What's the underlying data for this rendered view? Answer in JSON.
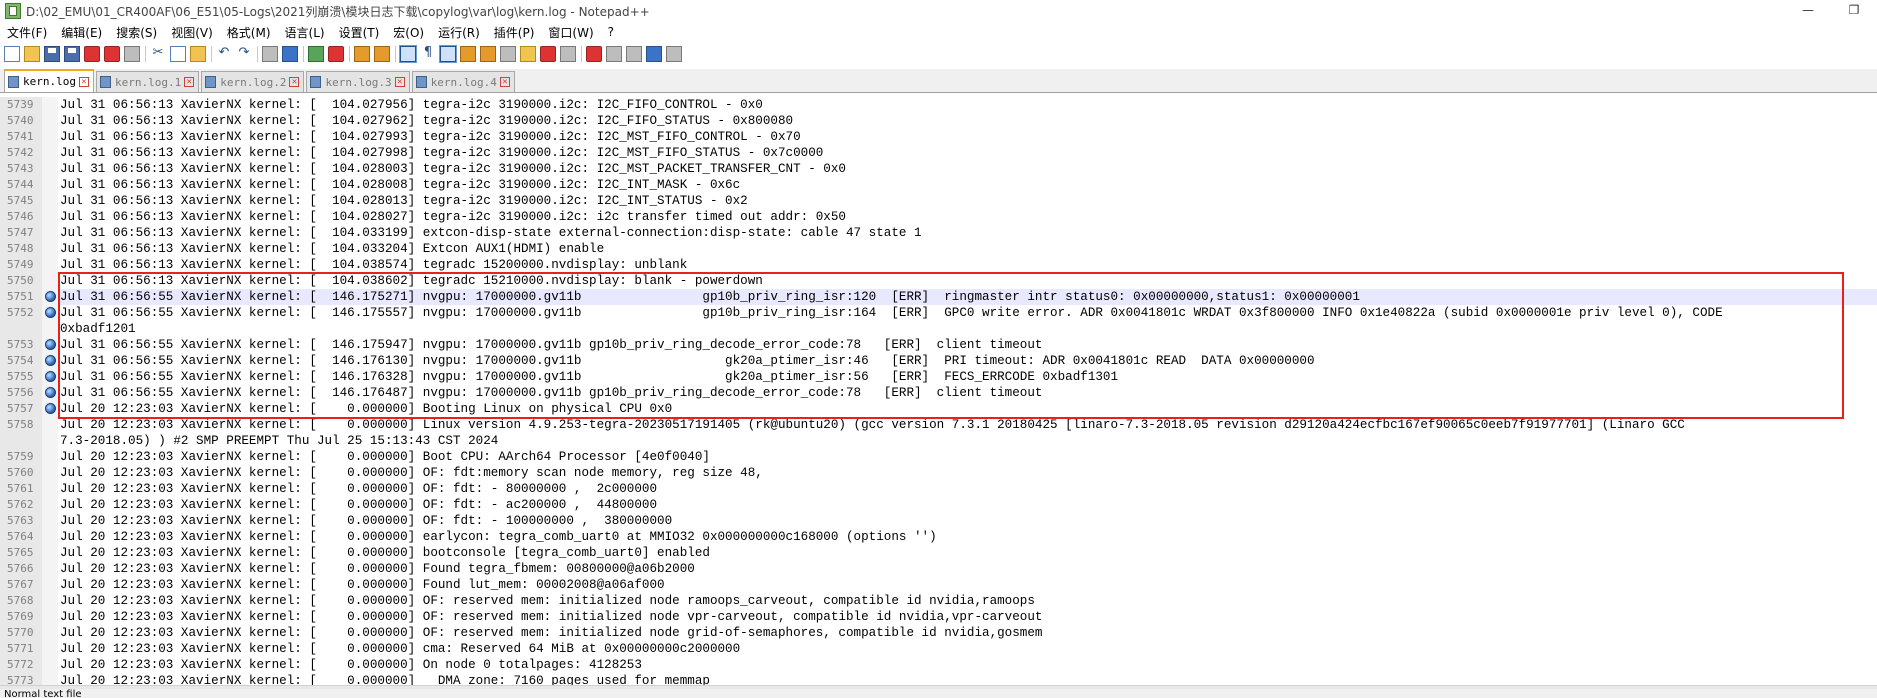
{
  "window": {
    "title": "D:\\02_EMU\\01_CR400AF\\06_E51\\05-Logs\\2021列崩溃\\模块日志下载\\copylog\\var\\log\\kern.log - Notepad++",
    "minimize": "—",
    "restore": "❐"
  },
  "menu": [
    "文件(F)",
    "编辑(E)",
    "搜索(S)",
    "视图(V)",
    "格式(M)",
    "语言(L)",
    "设置(T)",
    "宏(O)",
    "运行(R)",
    "插件(P)",
    "窗口(W)",
    "?"
  ],
  "tabs": [
    {
      "label": "kern.log",
      "active": true
    },
    {
      "label": "kern.log.1",
      "active": false
    },
    {
      "label": "kern.log.2",
      "active": false
    },
    {
      "label": "kern.log.3",
      "active": false
    },
    {
      "label": "kern.log.4",
      "active": false
    }
  ],
  "lines": [
    {
      "num": "5739",
      "text": "Jul 31 06:56:13 XavierNX kernel: [  104.027956] tegra-i2c 3190000.i2c: I2C_FIFO_CONTROL - 0x0"
    },
    {
      "num": "5740",
      "text": "Jul 31 06:56:13 XavierNX kernel: [  104.027962] tegra-i2c 3190000.i2c: I2C_FIFO_STATUS - 0x800080"
    },
    {
      "num": "5741",
      "text": "Jul 31 06:56:13 XavierNX kernel: [  104.027993] tegra-i2c 3190000.i2c: I2C_MST_FIFO_CONTROL - 0x70"
    },
    {
      "num": "5742",
      "text": "Jul 31 06:56:13 XavierNX kernel: [  104.027998] tegra-i2c 3190000.i2c: I2C_MST_FIFO_STATUS - 0x7c0000"
    },
    {
      "num": "5743",
      "text": "Jul 31 06:56:13 XavierNX kernel: [  104.028003] tegra-i2c 3190000.i2c: I2C_MST_PACKET_TRANSFER_CNT - 0x0"
    },
    {
      "num": "5744",
      "text": "Jul 31 06:56:13 XavierNX kernel: [  104.028008] tegra-i2c 3190000.i2c: I2C_INT_MASK - 0x6c"
    },
    {
      "num": "5745",
      "text": "Jul 31 06:56:13 XavierNX kernel: [  104.028013] tegra-i2c 3190000.i2c: I2C_INT_STATUS - 0x2"
    },
    {
      "num": "5746",
      "text": "Jul 31 06:56:13 XavierNX kernel: [  104.028027] tegra-i2c 3190000.i2c: i2c transfer timed out addr: 0x50"
    },
    {
      "num": "5747",
      "text": "Jul 31 06:56:13 XavierNX kernel: [  104.033199] extcon-disp-state external-connection:disp-state: cable 47 state 1"
    },
    {
      "num": "5748",
      "text": "Jul 31 06:56:13 XavierNX kernel: [  104.033204] Extcon AUX1(HDMI) enable"
    },
    {
      "num": "5749",
      "text": "Jul 31 06:56:13 XavierNX kernel: [  104.038574] tegradc 15200000.nvdisplay: unblank"
    },
    {
      "num": "5750",
      "text": "Jul 31 06:56:13 XavierNX kernel: [  104.038602] tegradc 15210000.nvdisplay: blank - powerdown"
    },
    {
      "num": "5751",
      "text": "Jul 31 06:56:55 XavierNX kernel: [  146.175271] nvgpu: 17000000.gv11b                gp10b_priv_ring_isr:120  [ERR]  ringmaster intr status0: 0x00000000,status1: 0x00000001",
      "bookmark": true,
      "current": true
    },
    {
      "num": "5752",
      "text": "Jul 31 06:56:55 XavierNX kernel: [  146.175557] nvgpu: 17000000.gv11b                gp10b_priv_ring_isr:164  [ERR]  GPC0 write error. ADR 0x0041801c WRDAT 0x3f800000 INFO 0x1e40822a (subid 0x0000001e priv level 0), CODE",
      "bookmark": true
    },
    {
      "num": "",
      "text": "0xbadf1201"
    },
    {
      "num": "5753",
      "text": "Jul 31 06:56:55 XavierNX kernel: [  146.175947] nvgpu: 17000000.gv11b gp10b_priv_ring_decode_error_code:78   [ERR]  client timeout",
      "bookmark": true
    },
    {
      "num": "5754",
      "text": "Jul 31 06:56:55 XavierNX kernel: [  146.176130] nvgpu: 17000000.gv11b                   gk20a_ptimer_isr:46   [ERR]  PRI timeout: ADR 0x0041801c READ  DATA 0x00000000",
      "bookmark": true
    },
    {
      "num": "5755",
      "text": "Jul 31 06:56:55 XavierNX kernel: [  146.176328] nvgpu: 17000000.gv11b                   gk20a_ptimer_isr:56   [ERR]  FECS_ERRCODE 0xbadf1301",
      "bookmark": true
    },
    {
      "num": "5756",
      "text": "Jul 31 06:56:55 XavierNX kernel: [  146.176487] nvgpu: 17000000.gv11b gp10b_priv_ring_decode_error_code:78   [ERR]  client timeout",
      "bookmark": true
    },
    {
      "num": "5757",
      "text": "Jul 20 12:23:03 XavierNX kernel: [    0.000000] Booting Linux on physical CPU 0x0",
      "bookmark": true
    },
    {
      "num": "5758",
      "text": "Jul 20 12:23:03 XavierNX kernel: [    0.000000] Linux version 4.9.253-tegra-20230517191405 (rk@ubuntu20) (gcc version 7.3.1 20180425 [linaro-7.3-2018.05 revision d29120a424ecfbc167ef90065c0eeb7f91977701] (Linaro GCC"
    },
    {
      "num": "",
      "text": "7.3-2018.05) ) #2 SMP PREEMPT Thu Jul 25 15:13:43 CST 2024"
    },
    {
      "num": "5759",
      "text": "Jul 20 12:23:03 XavierNX kernel: [    0.000000] Boot CPU: AArch64 Processor [4e0f0040]"
    },
    {
      "num": "5760",
      "text": "Jul 20 12:23:03 XavierNX kernel: [    0.000000] OF: fdt:memory scan node memory, reg size 48,"
    },
    {
      "num": "5761",
      "text": "Jul 20 12:23:03 XavierNX kernel: [    0.000000] OF: fdt: - 80000000 ,  2c000000"
    },
    {
      "num": "5762",
      "text": "Jul 20 12:23:03 XavierNX kernel: [    0.000000] OF: fdt: - ac200000 ,  44800000"
    },
    {
      "num": "5763",
      "text": "Jul 20 12:23:03 XavierNX kernel: [    0.000000] OF: fdt: - 100000000 ,  380000000"
    },
    {
      "num": "5764",
      "text": "Jul 20 12:23:03 XavierNX kernel: [    0.000000] earlycon: tegra_comb_uart0 at MMIO32 0x000000000c168000 (options '')"
    },
    {
      "num": "5765",
      "text": "Jul 20 12:23:03 XavierNX kernel: [    0.000000] bootconsole [tegra_comb_uart0] enabled"
    },
    {
      "num": "5766",
      "text": "Jul 20 12:23:03 XavierNX kernel: [    0.000000] Found tegra_fbmem: 00800000@a06b2000"
    },
    {
      "num": "5767",
      "text": "Jul 20 12:23:03 XavierNX kernel: [    0.000000] Found lut_mem: 00002008@a06af000"
    },
    {
      "num": "5768",
      "text": "Jul 20 12:23:03 XavierNX kernel: [    0.000000] OF: reserved mem: initialized node ramoops_carveout, compatible id nvidia,ramoops"
    },
    {
      "num": "5769",
      "text": "Jul 20 12:23:03 XavierNX kernel: [    0.000000] OF: reserved mem: initialized node vpr-carveout, compatible id nvidia,vpr-carveout"
    },
    {
      "num": "5770",
      "text": "Jul 20 12:23:03 XavierNX kernel: [    0.000000] OF: reserved mem: initialized node grid-of-semaphores, compatible id nvidia,gosmem"
    },
    {
      "num": "5771",
      "text": "Jul 20 12:23:03 XavierNX kernel: [    0.000000] cma: Reserved 64 MiB at 0x00000000c2000000"
    },
    {
      "num": "5772",
      "text": "Jul 20 12:23:03 XavierNX kernel: [    0.000000] On node 0 totalpages: 4128253"
    },
    {
      "num": "5773",
      "text": "Jul 20 12:23:03 XavierNX kernel: [    0.000000]   DMA zone: 7160 pages used for memmap"
    }
  ],
  "status": {
    "text": "Normal text file"
  }
}
